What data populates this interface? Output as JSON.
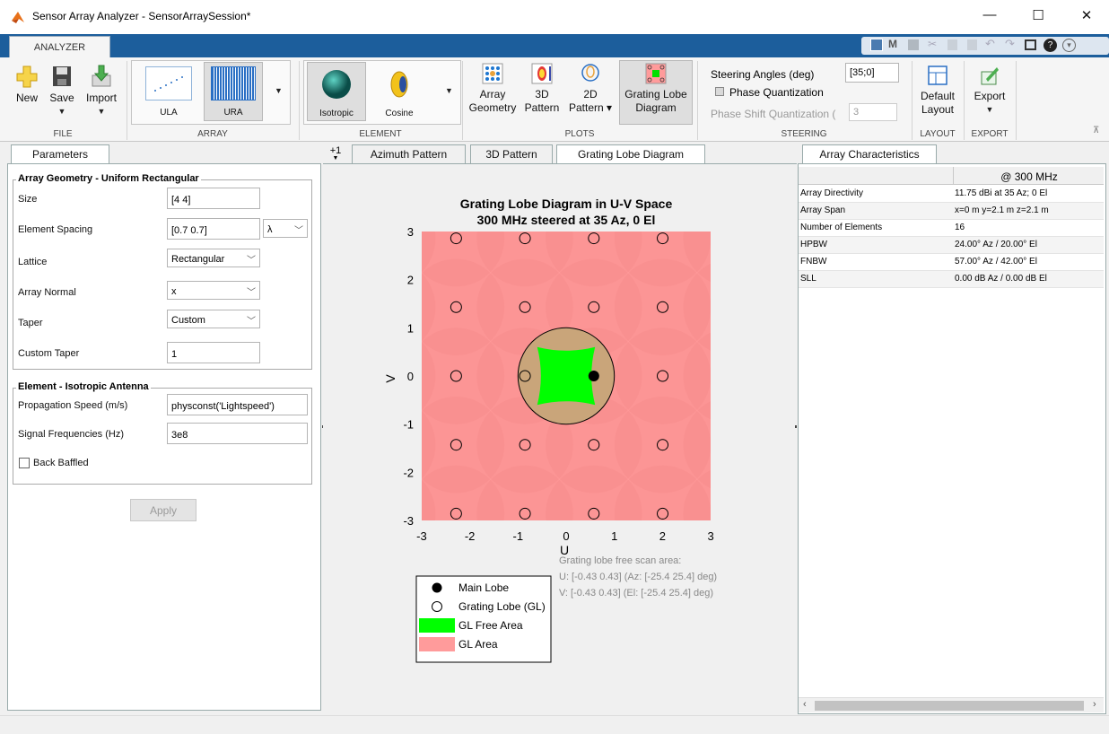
{
  "window": {
    "title": "Sensor Array Analyzer - SensorArraySession*",
    "minimize": "—",
    "maximize": "☐",
    "close": "✕"
  },
  "ribbon": {
    "tab": "ANALYZER",
    "file": {
      "label": "FILE",
      "new": "New",
      "save": "Save",
      "import": "Import"
    },
    "array": {
      "label": "ARRAY",
      "ula": "ULA",
      "ura": "URA"
    },
    "element": {
      "label": "ELEMENT",
      "isotropic": "Isotropic",
      "cosine": "Cosine"
    },
    "plots": {
      "label": "PLOTS",
      "array_geometry": [
        "Array",
        "Geometry"
      ],
      "pattern3d": [
        "3D",
        "Pattern"
      ],
      "pattern2d": [
        "2D",
        "Pattern ▾"
      ],
      "grating": [
        "Grating Lobe",
        "Diagram"
      ]
    },
    "steering": {
      "label": "STEERING",
      "angles_label": "Steering Angles (deg)",
      "angles_value": "[35;0]",
      "phase_quant": "Phase Quantization",
      "phase_shift_label": "Phase Shift Quantization (",
      "phase_shift_value": "3"
    },
    "layout": {
      "label": "LAYOUT",
      "default": [
        "Default",
        "Layout"
      ]
    },
    "export": {
      "label": "EXPORT",
      "export": "Export"
    }
  },
  "parameters": {
    "tab": "Parameters",
    "geometry_group": "Array Geometry - Uniform Rectangular",
    "size_label": "Size",
    "size_value": "[4 4]",
    "spacing_label": "Element Spacing",
    "spacing_value": "[0.7 0.7]",
    "spacing_unit": "λ",
    "lattice_label": "Lattice",
    "lattice_value": "Rectangular",
    "normal_label": "Array Normal",
    "normal_value": "x",
    "taper_label": "Taper",
    "taper_value": "Custom",
    "custom_taper_label": "Custom Taper",
    "custom_taper_value": "1",
    "element_group": "Element - Isotropic Antenna",
    "speed_label": "Propagation Speed (m/s)",
    "speed_value": "physconst('Lightspeed')",
    "freq_label": "Signal Frequencies (Hz)",
    "freq_value": "3e8",
    "baffled_label": "Back Baffled",
    "apply": "Apply"
  },
  "plot_tabs": {
    "more": "+1",
    "azimuth": "Azimuth Pattern",
    "pattern3d": "3D Pattern",
    "grating": "Grating Lobe Diagram"
  },
  "grating_plot": {
    "title1": "Grating Lobe Diagram in U-V Space",
    "title2": "300 MHz steered at 35 Az, 0 El",
    "xlabel": "U",
    "ylabel": "V",
    "xticks": [
      "-3",
      "-2",
      "-1",
      "0",
      "1",
      "2",
      "3"
    ],
    "yticks": [
      "3",
      "2",
      "1",
      "0",
      "-1",
      "-2",
      "-3"
    ],
    "legend": [
      "Main Lobe",
      "Grating Lobe (GL)",
      "GL Free Area",
      "GL Area"
    ],
    "info": [
      "Grating lobe free scan area:",
      "U: [-0.43 0.43] (Az: [-25.4 25.4] deg)",
      "V: [-0.43 0.43] (El: [-25.4 25.4] deg)"
    ],
    "colors": {
      "gl_area": "#ff9b9b",
      "gl_free": "#00ff00",
      "visible": "#c9a57a"
    }
  },
  "characteristics": {
    "tab": "Array Characteristics",
    "column": "@ 300 MHz",
    "rows": [
      {
        "name": "Array Directivity",
        "value": "11.75 dBi at 35 Az; 0 El"
      },
      {
        "name": "Array Span",
        "value": "x=0 m y=2.1 m z=2.1 m"
      },
      {
        "name": "Number of Elements",
        "value": "16"
      },
      {
        "name": "HPBW",
        "value": "24.00° Az / 20.00° El"
      },
      {
        "name": "FNBW",
        "value": "57.00° Az / 42.00° El"
      },
      {
        "name": "SLL",
        "value": "0.00 dB Az / 0.00 dB El"
      }
    ]
  }
}
